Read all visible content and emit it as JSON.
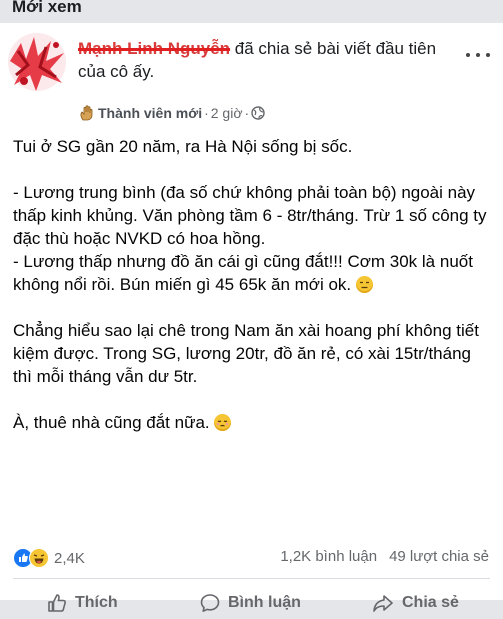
{
  "header": {
    "section_label": "Mới xem"
  },
  "post": {
    "author_name": "Mạnh Linh Nguyễn",
    "action_text": " đã chia sẻ bài viết đầu tiên của cô ấy.",
    "role_label": "Thành viên mới",
    "separator": "·",
    "time": "2 giờ",
    "separator2": "·",
    "privacy_icon": "globe-icon",
    "more_icon": "more-dots-icon",
    "paragraphs": [
      "Tui ở SG gần 20 năm, ra Hà Nội sống bị sốc.",
      "",
      "- Lương trung bình (đa số chứ không phải toàn bộ) ngoài này thấp kinh khủng. Văn phòng tầm 6 - 8tr/tháng. Trừ 1 số công ty đặc thù hoặc NVKD có hoa hồng.",
      "- Lương thấp nhưng đồ ăn cái gì cũng đắt!!! Cơm 30k là nuốt không nổi rồi. Bún miến gì 45 65k ăn mới ok.",
      "",
      "Chẳng hiểu sao lại chê trong Nam ăn xài hoang phí không tiết kiệm được. Trong SG, lương 20tr, đồ ăn rẻ, có xài 15tr/tháng thì mỗi tháng vẫn dư 5tr.",
      "",
      "À, thuê nhà cũng đắt nữa."
    ]
  },
  "stats": {
    "reaction_icons": [
      "like-icon",
      "haha-icon"
    ],
    "reaction_count": "2,4K",
    "comments": "1,2K bình luận",
    "shares": "49 lượt chia sẻ"
  },
  "actions": {
    "like": "Thích",
    "comment": "Bình luận",
    "share": "Chia sẻ"
  },
  "colors": {
    "like_blue": "#1877f2",
    "emoji_yellow": "#f6c533",
    "muted_text": "#65676b"
  }
}
